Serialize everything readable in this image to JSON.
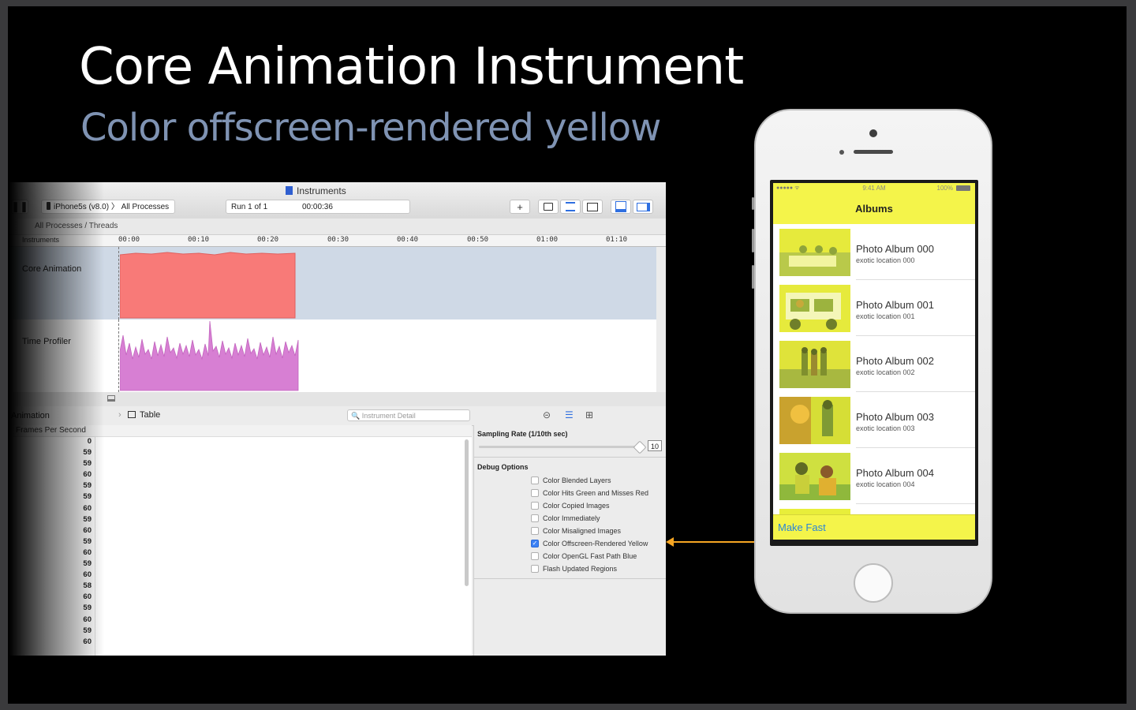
{
  "slide": {
    "title": "Core Animation Instrument",
    "subtitle": "Color offscreen-rendered yellow"
  },
  "instruments": {
    "window_title": "Instruments",
    "device": "iPhone5s (v8.0)",
    "target": "All Processes",
    "run": "Run 1 of 1",
    "time": "00:00:36",
    "add_label": "+",
    "breadcrumb": "All Processes / Threads",
    "ruler_header": "Instruments",
    "ruler_ticks": [
      "00:00",
      "00:10",
      "00:20",
      "00:30",
      "00:40",
      "00:50",
      "01:00",
      "01:10"
    ],
    "tracks": [
      {
        "label": "Core Animation",
        "color": "#f87a78"
      },
      {
        "label": "Time Profiler",
        "color": "#d77fd3"
      }
    ],
    "detail_left_label": "Animation",
    "table_label": "Table",
    "search_placeholder": "Instrument Detail",
    "column_header": "Frames Per Second",
    "fps_values": [
      "0",
      "59",
      "59",
      "60",
      "59",
      "59",
      "60",
      "59",
      "60",
      "59",
      "60",
      "59",
      "60",
      "58",
      "60",
      "59",
      "60",
      "59",
      "60"
    ],
    "sampling_rate_label": "Sampling Rate (1/10th sec)",
    "sampling_rate_value": "10",
    "debug_options_label": "Debug Options",
    "debug_options": [
      {
        "label": "Color Blended Layers",
        "checked": false
      },
      {
        "label": "Color Hits Green and Misses Red",
        "checked": false
      },
      {
        "label": "Color Copied Images",
        "checked": false
      },
      {
        "label": "Color Immediately",
        "checked": false
      },
      {
        "label": "Color Misaligned Images",
        "checked": false
      },
      {
        "label": "Color Offscreen-Rendered Yellow",
        "checked": true
      },
      {
        "label": "Color OpenGL Fast Path Blue",
        "checked": false
      },
      {
        "label": "Flash Updated Regions",
        "checked": false
      }
    ]
  },
  "phone": {
    "status_time": "9:41 AM",
    "status_battery": "100%",
    "nav_title": "Albums",
    "albums": [
      {
        "title": "Photo Album 000",
        "subtitle": "exotic location 000"
      },
      {
        "title": "Photo Album 001",
        "subtitle": "exotic location 001"
      },
      {
        "title": "Photo Album 002",
        "subtitle": "exotic location 002"
      },
      {
        "title": "Photo Album 003",
        "subtitle": "exotic location 003"
      },
      {
        "title": "Photo Album 004",
        "subtitle": "exotic location 004"
      }
    ],
    "toolbar_button": "Make Fast",
    "highlight_color": "#f4f44a"
  },
  "colors": {
    "arrow": "#f6a623",
    "subtitle": "#7f93b3"
  }
}
